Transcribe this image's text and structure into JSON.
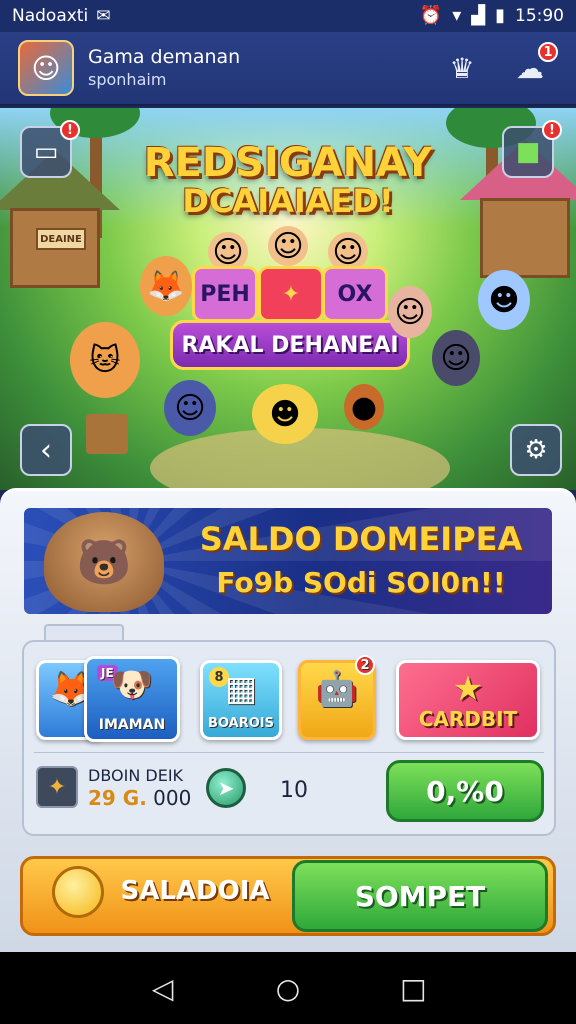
{
  "status_bar": {
    "carrier": "Nadoaxti",
    "time": "15:90",
    "icons": [
      "app-notification-icon",
      "alarm-icon",
      "wifi-icon",
      "signal-icon",
      "battery-icon"
    ]
  },
  "header": {
    "title": "Gama demanan",
    "subtitle": "sponhaim",
    "notification_count": "1"
  },
  "hero": {
    "title_line1": "REDSIGANAY",
    "title_line2": "DCAIAIAED!",
    "tiles": [
      "PEH",
      "",
      "OX"
    ],
    "banner_text": "RAKAL DEHANEAI",
    "corner_badge_left": "!",
    "corner_badge_right": "!",
    "hut_sign": "DEAINE"
  },
  "promo": {
    "title": "SALDO DOMEIPEA",
    "subtitle": "Fo9b SOdi SOI0n!!"
  },
  "cards": {
    "dog_tag": "JE",
    "dog_label": "IMAMAN",
    "board_number": "8",
    "board_label": "BOAROIS",
    "robot_badge": "2",
    "combat_label": "CARDBIT"
  },
  "stats": {
    "label": "DBOIN DEIK",
    "value_highlight": "29 G.",
    "value_rest": "000",
    "gem_count": "10",
    "price": "0,%0"
  },
  "actions": {
    "left_label": "SALADOIA",
    "cta_label": "SOMPET"
  },
  "colors": {
    "header_bg": "#2a3f86",
    "accent_gold": "#ffd23a",
    "cta_green": "#2fa83a",
    "action_orange": "#f09218"
  }
}
